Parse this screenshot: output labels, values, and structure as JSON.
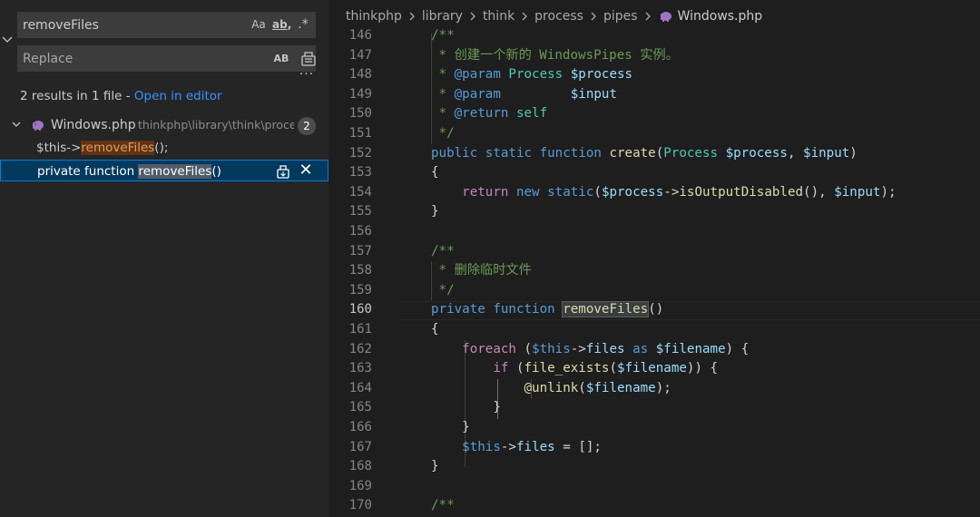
{
  "search": {
    "query": "removeFiles",
    "match_case_label": "Aa",
    "whole_word_label": "ab",
    "regex_label": ".*",
    "replace_placeholder": "Replace",
    "preserve_case_label": "AB",
    "more_label": "···",
    "summary_text": "2 results in 1 file - ",
    "open_in_editor": "Open in editor"
  },
  "results": {
    "file_name": "Windows.php",
    "file_path": "thinkphp\\library\\think\\process\\pipes",
    "count": "2",
    "matches": [
      {
        "before": "$this->",
        "match": "removeFiles",
        "after": "();"
      },
      {
        "before": "private function ",
        "match": "removeFiles",
        "after": "()"
      }
    ],
    "dismiss_label": "✕"
  },
  "breadcrumb": {
    "items": [
      "thinkphp",
      "library",
      "think",
      "process",
      "pipes"
    ],
    "file": "Windows.php"
  },
  "editor": {
    "current_line": "160",
    "line_numbers": [
      "146",
      "147",
      "148",
      "149",
      "150",
      "151",
      "152",
      "153",
      "154",
      "155",
      "156",
      "157",
      "158",
      "159",
      "160",
      "161",
      "162",
      "163",
      "164",
      "165",
      "166",
      "167",
      "168",
      "169",
      "170"
    ],
    "lines": {
      "l146": "/**",
      "l147_a": " * ",
      "l147_b": "创建一个新的 WindowsPipes 实例。",
      "l148_a": " * ",
      "l148_tag": "@param",
      "l148_type": " Process",
      "l148_var": " $process",
      "l149_a": " * ",
      "l149_tag": "@param",
      "l149_var": "         $input",
      "l150_a": " * ",
      "l150_tag": "@return",
      "l150_type": " self",
      "l151": " */",
      "l152_kw": "public static function ",
      "l152_fn": "create",
      "l152_p1": "(",
      "l152_cls": "Process",
      "l152_v1": " $process",
      "l152_p2": ", ",
      "l152_v2": "$input",
      "l152_p3": ")",
      "l153": "{",
      "l154_ctl": "    return ",
      "l154_kw": "new static",
      "l154_p1": "(",
      "l154_v1": "$process",
      "l154_p2": "->",
      "l154_fn": "isOutputDisabled",
      "l154_p3": "(), ",
      "l154_v2": "$input",
      "l154_p4": ");",
      "l155": "}",
      "l157": "/**",
      "l158_a": " * ",
      "l158_b": "删除临时文件",
      "l159": " */",
      "l160_kw": "private function ",
      "l160_fn": "removeFiles",
      "l160_p": "()",
      "l161": "{",
      "l162_ctl": "    foreach ",
      "l162_p1": "(",
      "l162_v1": "$this",
      "l162_p2": "->",
      "l162_v2": "files",
      "l162_kw": " as ",
      "l162_v3": "$filename",
      "l162_p3": ") {",
      "l163_ctl": "        if ",
      "l163_p1": "(",
      "l163_fn": "file_exists",
      "l163_p2": "(",
      "l163_v": "$filename",
      "l163_p3": ")) {",
      "l164_a": "            ",
      "l164_fn": "@unlink",
      "l164_p1": "(",
      "l164_v": "$filename",
      "l164_p2": ");",
      "l165": "        }",
      "l166": "    }",
      "l167_a": "    ",
      "l167_v1": "$this",
      "l167_p1": "->",
      "l167_v2": "files",
      "l167_p2": " = [];",
      "l168": "}",
      "l170": "/**"
    }
  },
  "colors": {
    "accent": "#007fd4",
    "link": "#3794ff",
    "match_highlight": "#613214",
    "selection": "#04395e"
  }
}
